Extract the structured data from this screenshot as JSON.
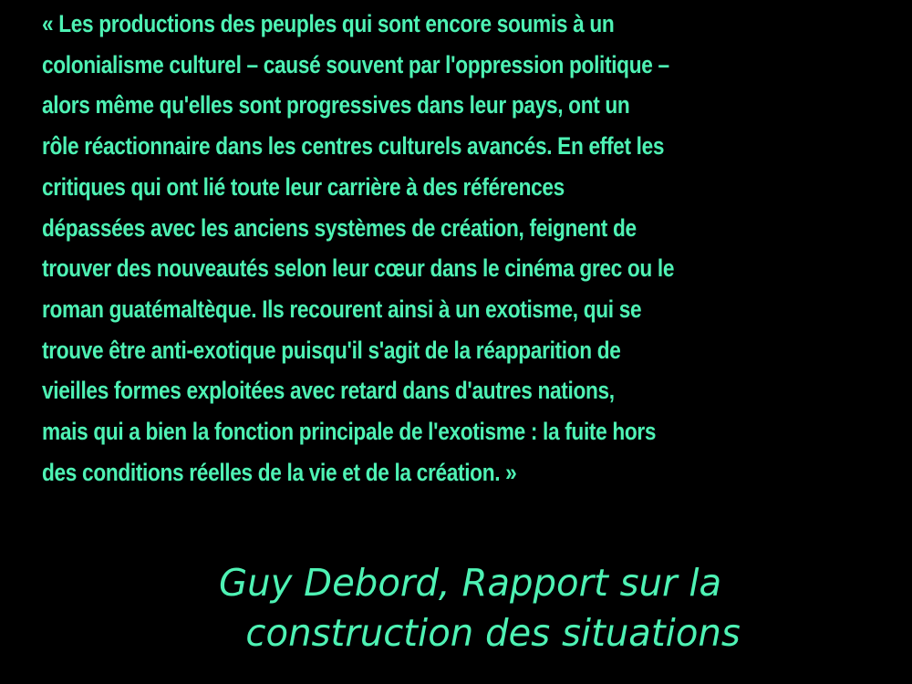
{
  "slide": {
    "background": "#000000",
    "text_color": "#4ef2b4",
    "quote_lines": [
      "« Les productions des peuples qui sont encore soumis à un",
      "colonialisme culturel – causé souvent par l'oppression politique –",
      "alors même qu'elles sont progressives dans leur pays, ont un",
      "rôle réactionnaire dans les centres culturels avancés. En effet les",
      "critiques qui ont lié toute leur carrière à des références",
      "dépassées avec les anciens systèmes de création, feignent de",
      "trouver des nouveautés selon leur cœur dans le cinéma grec ou le",
      "roman guatémaltèque. Ils recourent ainsi à un exotisme, qui se",
      "trouve être anti-exotique puisqu'il s'agit de la réapparition de",
      "vieilles formes exploitées avec retard dans d'autres nations,",
      "mais qui a bien la fonction principale de l'exotisme : la fuite hors",
      "des conditions réelles de la vie et de la création. »"
    ],
    "attribution_lines": [
      "Guy Debord, Rapport sur la",
      "construction des situations"
    ]
  }
}
